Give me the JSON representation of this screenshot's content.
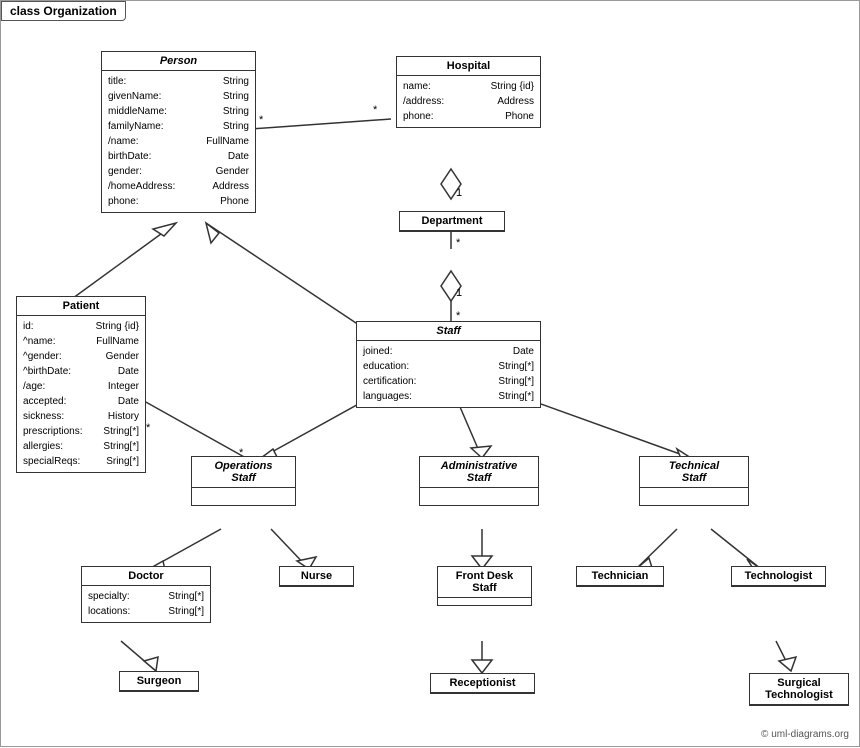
{
  "title": "class Organization",
  "classes": {
    "person": {
      "name": "Person",
      "italic": true,
      "attrs": [
        [
          "title:",
          "String"
        ],
        [
          "givenName:",
          "String"
        ],
        [
          "middleName:",
          "String"
        ],
        [
          "familyName:",
          "String"
        ],
        [
          "/name:",
          "FullName"
        ],
        [
          "birthDate:",
          "Date"
        ],
        [
          "gender:",
          "Gender"
        ],
        [
          "/homeAddress:",
          "Address"
        ],
        [
          "phone:",
          "Phone"
        ]
      ]
    },
    "hospital": {
      "name": "Hospital",
      "italic": false,
      "attrs": [
        [
          "name:",
          "String {id}"
        ],
        [
          "/address:",
          "Address"
        ],
        [
          "phone:",
          "Phone"
        ]
      ]
    },
    "patient": {
      "name": "Patient",
      "italic": false,
      "attrs": [
        [
          "id:",
          "String {id}"
        ],
        [
          "^name:",
          "FullName"
        ],
        [
          "^gender:",
          "Gender"
        ],
        [
          "^birthDate:",
          "Date"
        ],
        [
          "/age:",
          "Integer"
        ],
        [
          "accepted:",
          "Date"
        ],
        [
          "sickness:",
          "History"
        ],
        [
          "prescriptions:",
          "String[*]"
        ],
        [
          "allergies:",
          "String[*]"
        ],
        [
          "specialReqs:",
          "Sring[*]"
        ]
      ]
    },
    "department": {
      "name": "Department",
      "italic": false,
      "attrs": []
    },
    "staff": {
      "name": "Staff",
      "italic": true,
      "attrs": [
        [
          "joined:",
          "Date"
        ],
        [
          "education:",
          "String[*]"
        ],
        [
          "certification:",
          "String[*]"
        ],
        [
          "languages:",
          "String[*]"
        ]
      ]
    },
    "operationsStaff": {
      "name": "Operations\nStaff",
      "italic": true,
      "attrs": []
    },
    "administrativeStaff": {
      "name": "Administrative\nStaff",
      "italic": true,
      "attrs": []
    },
    "technicalStaff": {
      "name": "Technical\nStaff",
      "italic": true,
      "attrs": []
    },
    "doctor": {
      "name": "Doctor",
      "italic": false,
      "attrs": [
        [
          "specialty:",
          "String[*]"
        ],
        [
          "locations:",
          "String[*]"
        ]
      ]
    },
    "nurse": {
      "name": "Nurse",
      "italic": false,
      "attrs": []
    },
    "frontDeskStaff": {
      "name": "Front Desk\nStaff",
      "italic": false,
      "attrs": []
    },
    "technician": {
      "name": "Technician",
      "italic": false,
      "attrs": []
    },
    "technologist": {
      "name": "Technologist",
      "italic": false,
      "attrs": []
    },
    "surgeon": {
      "name": "Surgeon",
      "italic": false,
      "attrs": []
    },
    "receptionist": {
      "name": "Receptionist",
      "italic": false,
      "attrs": []
    },
    "surgicalTechnologist": {
      "name": "Surgical\nTechnologist",
      "italic": false,
      "attrs": []
    }
  },
  "copyright": "© uml-diagrams.org"
}
